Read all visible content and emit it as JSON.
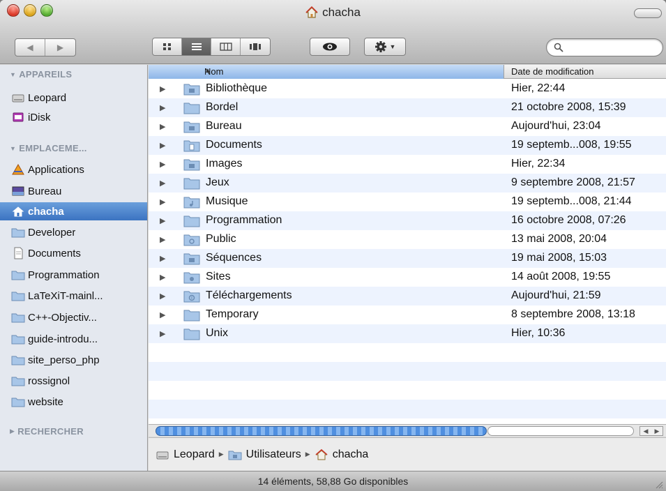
{
  "window": {
    "title": "chacha"
  },
  "toolbar": {
    "back_icon": "back-arrow-icon",
    "forward_icon": "forward-arrow-icon",
    "view_modes": [
      "icon-view",
      "list-view",
      "column-view",
      "coverflow-view"
    ],
    "active_view": "list-view",
    "quicklook_icon": "eye-icon",
    "action_icon": "gear-icon",
    "search": {
      "placeholder": "",
      "value": ""
    }
  },
  "sidebar": {
    "sections": [
      {
        "title": "APPAREILS",
        "expanded": true,
        "items": [
          {
            "label": "Leopard",
            "icon": "hard-drive-icon"
          },
          {
            "label": "iDisk",
            "icon": "idisk-icon"
          }
        ]
      },
      {
        "title": "EMPLACEME...",
        "expanded": true,
        "items": [
          {
            "label": "Applications",
            "icon": "applications-icon"
          },
          {
            "label": "Bureau",
            "icon": "desktop-icon"
          },
          {
            "label": "chacha",
            "icon": "home-icon",
            "selected": true
          },
          {
            "label": "Developer",
            "icon": "folder-icon"
          },
          {
            "label": "Documents",
            "icon": "document-icon"
          },
          {
            "label": "Programmation",
            "icon": "folder-icon"
          },
          {
            "label": "LaTeXiT-mainl...",
            "icon": "folder-icon"
          },
          {
            "label": "C++-Objectiv...",
            "icon": "folder-icon"
          },
          {
            "label": "guide-introdu...",
            "icon": "folder-icon"
          },
          {
            "label": "site_perso_php",
            "icon": "folder-icon"
          },
          {
            "label": "rossignol",
            "icon": "folder-icon"
          },
          {
            "label": "website",
            "icon": "folder-icon"
          }
        ]
      },
      {
        "title": "RECHERCHER",
        "expanded": false,
        "items": []
      }
    ]
  },
  "list": {
    "columns": {
      "name": "Nom",
      "date": "Date de modification"
    },
    "rows": [
      {
        "name": "Bibliothèque",
        "date": "Hier, 22:44"
      },
      {
        "name": "Bordel",
        "date": "21 octobre 2008, 15:39"
      },
      {
        "name": "Bureau",
        "date": "Aujourd'hui, 23:04"
      },
      {
        "name": "Documents",
        "date": "19 septemb...008, 19:55"
      },
      {
        "name": "Images",
        "date": "Hier, 22:34"
      },
      {
        "name": "Jeux",
        "date": "9 septembre 2008, 21:57"
      },
      {
        "name": "Musique",
        "date": "19 septemb...008, 21:44"
      },
      {
        "name": "Programmation",
        "date": "16 octobre 2008, 07:26"
      },
      {
        "name": "Public",
        "date": "13 mai 2008, 20:04"
      },
      {
        "name": "Séquences",
        "date": "19 mai 2008, 15:03"
      },
      {
        "name": "Sites",
        "date": "14 août 2008, 19:55"
      },
      {
        "name": "Téléchargements",
        "date": "Aujourd'hui, 21:59"
      },
      {
        "name": "Temporary",
        "date": "8 septembre 2008, 13:18"
      },
      {
        "name": "Unix",
        "date": "Hier, 10:36"
      }
    ]
  },
  "pathbar": {
    "items": [
      "Leopard",
      "Utilisateurs",
      "chacha"
    ]
  },
  "status": {
    "text": "14 éléments, 58,88 Go disponibles"
  },
  "colors": {
    "selection": "#3b73c1",
    "row_alt": "#edf3fe",
    "sidebar_bg": "#e4e8ef"
  }
}
